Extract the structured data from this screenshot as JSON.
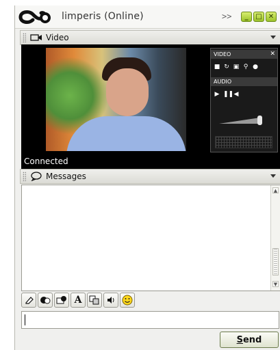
{
  "window": {
    "title": "limperis (Online)",
    "expand_label": ">>",
    "minimize_label": "_",
    "maximize_label": "□",
    "close_label": "✕"
  },
  "video": {
    "header_label": "Video",
    "status": "Connected",
    "controls": {
      "video_label": "VIDEO",
      "audio_label": "AUDIO",
      "close_label": "✕",
      "video_buttons": [
        "stop-icon",
        "refresh-icon",
        "snapshot-icon",
        "zoom-icon",
        "record-icon"
      ],
      "audio_buttons": [
        "play-icon",
        "pause-icon",
        "speaker-icon"
      ]
    }
  },
  "messages": {
    "header_label": "Messages",
    "content": ""
  },
  "toolbar": {
    "tools": [
      "eraser-icon",
      "stamp-icon",
      "whiteboard-icon",
      "font-icon",
      "file-transfer-icon",
      "sound-icon",
      "emoticon-icon"
    ],
    "font_glyph": "A"
  },
  "input": {
    "value": ""
  },
  "send": {
    "label_underlined": "S",
    "label_rest": "end"
  },
  "colors": {
    "window_bg": "#f0f0ee",
    "video_bg": "#000000",
    "accent_green": "#9cc22a"
  }
}
